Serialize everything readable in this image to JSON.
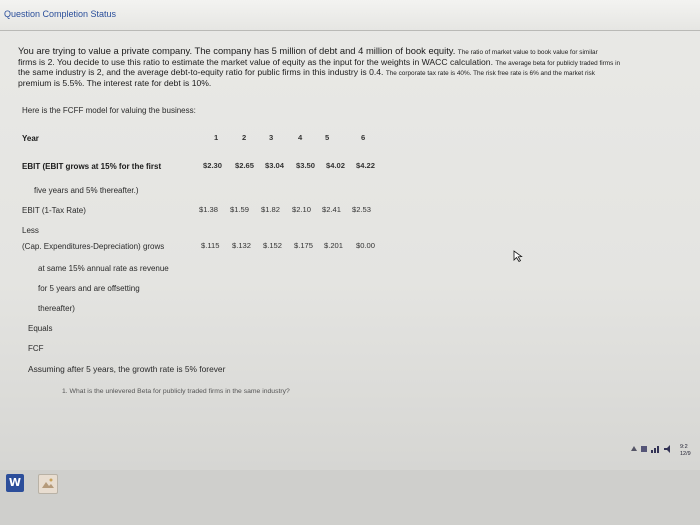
{
  "status_bar": {
    "title": "Question Completion Status"
  },
  "intro": {
    "sentence_big": "You are trying to value a private company. The company has 5 million of debt and 4 million of book equity.",
    "sentence_small_1": "The ratio of market value to book value for similar",
    "line2_a": "firms is 2. You decide to use this ratio to estimate the market value of equity as the input for the weights in WACC calculation.",
    "line2_small": "The average beta for publicly traded firms in",
    "line3_a": "the same industry is 2, and the average debt-to-equity ratio for public firms in this industry is 0.4.",
    "line3_small": "The corporate tax rate is 40%. The risk free rate is 6% and the market risk",
    "line4": "premium is 5.5%. The interest rate for debt is 10%."
  },
  "fcff_intro": "Here is the FCFF model for valuing the business:",
  "table": {
    "year_label": "Year",
    "years": [
      "1",
      "2",
      "3",
      "4",
      "5",
      "6"
    ],
    "ebit_label": "EBIT (EBIT grows at 15% for the first",
    "ebit_label_cont": "five years and 5% thereafter.)",
    "ebit_values": [
      "$2.30",
      "$2.65",
      "$3.04",
      "$3.50",
      "$4.02",
      "$4.22"
    ],
    "ebit_tax_label": "EBIT (1-Tax Rate)",
    "ebit_tax_values": [
      "$1.38",
      "$1.59",
      "$1.82",
      "$2.10",
      "$2.41",
      "$2.53"
    ],
    "less_label": "Less",
    "capex_label": "(Cap. Expenditures-Depreciation) grows",
    "capex_values": [
      "$.115",
      "$.132",
      "$.152",
      "$.175",
      "$.201",
      "$0.00"
    ],
    "capex_cont_1": "at same 15% annual rate as revenue",
    "capex_cont_2": "for 5 years and are offsetting",
    "capex_cont_3": "thereafter)",
    "equals_label": "Equals",
    "fcf_label": "FCF"
  },
  "assumption": "Assuming after 5 years, the growth rate is 5% forever",
  "question": "1. What is the unlevered Beta for publicly traded firms in the same industry?",
  "taskbar": {
    "word_icon_letter": "W",
    "clock_time": "9:2",
    "clock_date": "12/9"
  }
}
